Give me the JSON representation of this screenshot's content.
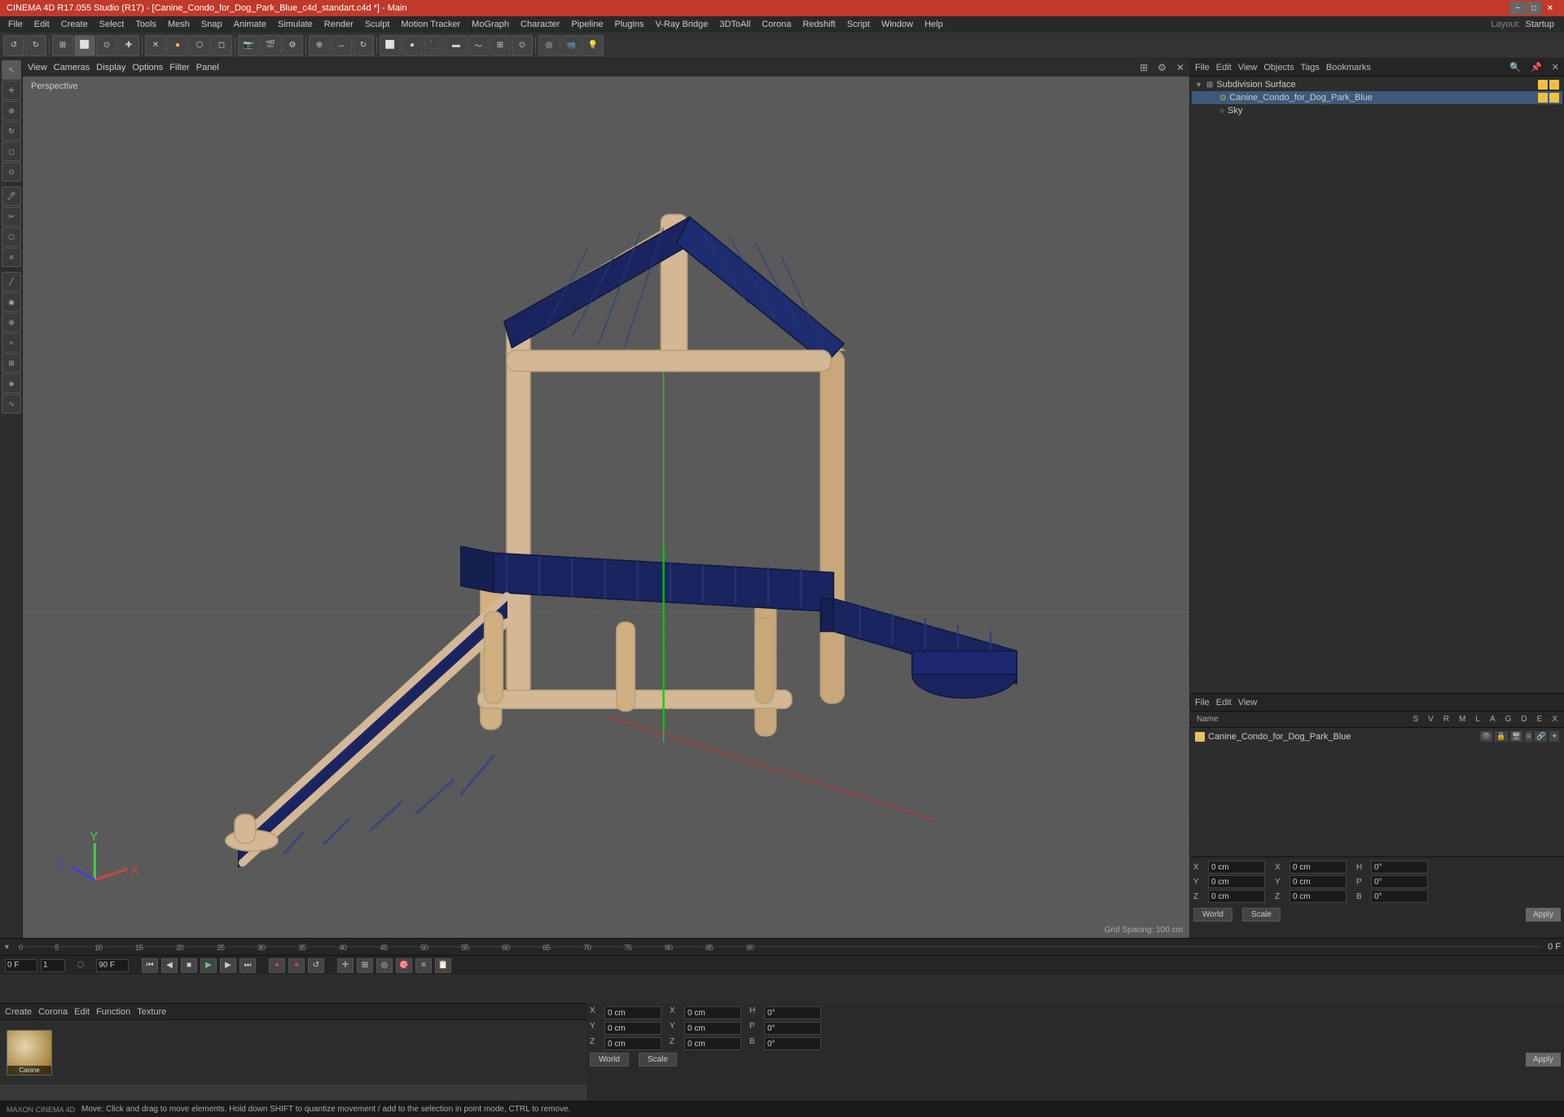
{
  "titlebar": {
    "title": "CINEMA 4D R17.055 Studio (R17) - [Canine_Condo_for_Dog_Park_Blue_c4d_standart.c4d *] - Main",
    "minimize": "−",
    "maximize": "□",
    "close": "✕"
  },
  "menubar": {
    "items": [
      "File",
      "Edit",
      "Create",
      "Select",
      "Tools",
      "Mesh",
      "Snap",
      "Animate",
      "Simulate",
      "Render",
      "Sculpt",
      "Motion Tracker",
      "MoGraph",
      "Character",
      "Pipeline",
      "Plugins",
      "V-Ray Bridge",
      "3DToAll",
      "Corona",
      "Redshift",
      "Script",
      "Window",
      "Help"
    ]
  },
  "layout": {
    "label": "Layout:",
    "value": "Startup"
  },
  "viewport": {
    "label": "Perspective",
    "grid_spacing": "Grid Spacing: 100 cm",
    "toolbar_items": [
      "View",
      "Cameras",
      "Display",
      "Options",
      "Filter",
      "Panel"
    ]
  },
  "object_manager": {
    "header_items": [
      "File",
      "Edit",
      "View",
      "Objects",
      "Tags",
      "Bookmarks"
    ],
    "objects": [
      {
        "name": "Subdivision Surface",
        "indent": 0,
        "has_expand": true,
        "color": "#f0c040",
        "icons": [
          "check",
          "check"
        ]
      },
      {
        "name": "Canine_Condo_for_Dog_Park_Blue",
        "indent": 1,
        "has_expand": false,
        "color": "#e8c060",
        "icons": [
          "check",
          "check"
        ]
      },
      {
        "name": "Sky",
        "indent": 1,
        "has_expand": false,
        "color": "#888888",
        "icons": []
      }
    ]
  },
  "attr_manager": {
    "header_items": [
      "File",
      "Edit",
      "View"
    ],
    "columns": [
      "Name",
      "S",
      "V",
      "R",
      "M",
      "L",
      "A",
      "G",
      "D",
      "E",
      "X"
    ],
    "items": [
      {
        "name": "Canine_Condo_for_Dog_Park_Blue",
        "color": "#e8c060"
      }
    ]
  },
  "coordinates": {
    "x_pos": "0 cm",
    "y_pos": "0 cm",
    "z_pos": "0 cm",
    "x_rot": "0 cm",
    "y_rot": "0 cm",
    "z_rot": "0 cm",
    "h_val": "0°",
    "p_val": "0°",
    "b_val": "0°",
    "mode_world": "World",
    "mode_scale": "Scale",
    "apply_btn": "Apply"
  },
  "timeline": {
    "start_frame": "0",
    "end_frame": "90 F",
    "current_frame": "0 F",
    "fps": "0 F",
    "ticks": [
      0,
      5,
      10,
      15,
      20,
      25,
      30,
      35,
      40,
      45,
      50,
      55,
      60,
      65,
      70,
      75,
      80,
      85,
      90
    ]
  },
  "playback": {
    "frame_start": "0 F",
    "frame_input": "0",
    "fps_input": "1",
    "end_frame": "90 F"
  },
  "material": {
    "header_items": [
      "Create",
      "Corona",
      "Edit",
      "Function",
      "Texture"
    ],
    "items": [
      {
        "name": "Canine",
        "type": "standard"
      }
    ]
  },
  "statusbar": {
    "message": "Move: Click and drag to move elements. Hold down SHIFT to quantize movement / add to the selection in point mode, CTRL to remove."
  },
  "icons": {
    "arrow": "↖",
    "move": "✛",
    "scale": "⊕",
    "rotate": "↻",
    "select_rect": "⬜",
    "live_select": "⊙",
    "play": "▶",
    "stop": "■",
    "rewind": "⏮",
    "forward": "⏭",
    "prev_frame": "◀",
    "next_frame": "▶",
    "record": "⏺",
    "loop": "↺"
  }
}
